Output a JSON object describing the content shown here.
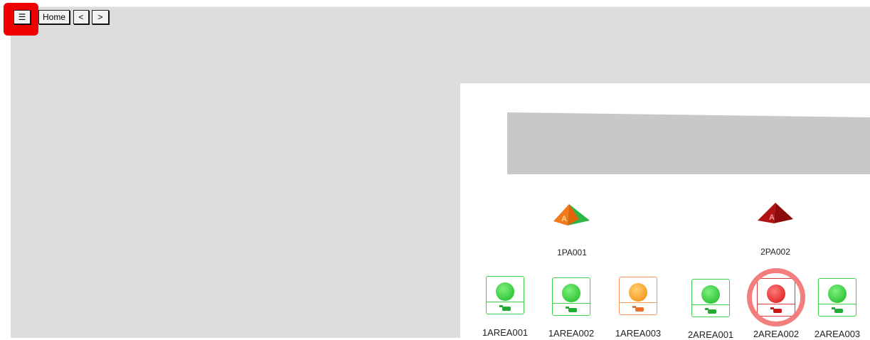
{
  "toolbar": {
    "menu_label": "☰",
    "home_label": "Home",
    "back_label": "<",
    "forward_label": ">"
  },
  "colors": {
    "canvas": "#dcdcdc",
    "highlight": "#ee0000",
    "ok": "#22cc33",
    "warning": "#f59a0c",
    "alarm": "#e01b1b",
    "alarm_ring": "#f47e7e"
  },
  "pump_stations": [
    {
      "id": "1PA001",
      "icon": "pyramid-orange-green-icon"
    },
    {
      "id": "2PA002",
      "icon": "pyramid-red-icon"
    }
  ],
  "areas": [
    {
      "id": "1AREA001",
      "status": "ok"
    },
    {
      "id": "1AREA002",
      "status": "ok"
    },
    {
      "id": "1AREA003",
      "status": "warning"
    },
    {
      "id": "2AREA001",
      "status": "ok"
    },
    {
      "id": "2AREA002",
      "status": "alarm"
    },
    {
      "id": "2AREA003",
      "status": "ok"
    }
  ]
}
